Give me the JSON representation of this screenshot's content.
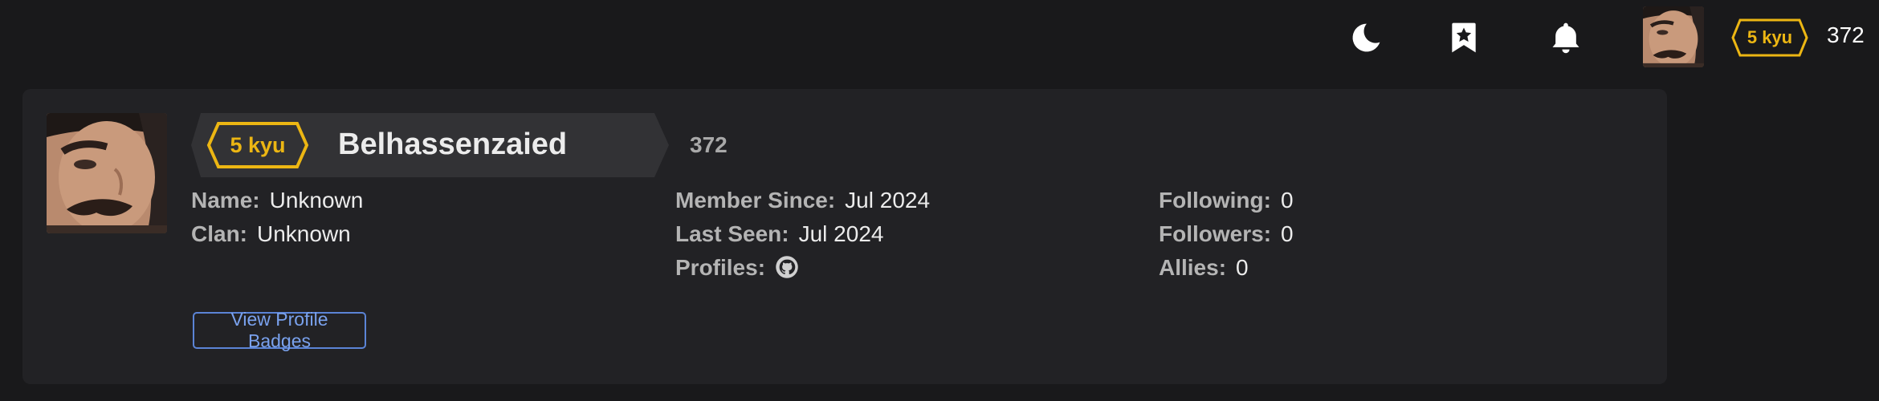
{
  "topbar": {
    "icons": [
      "moon-icon",
      "bookmark-star-icon",
      "bell-icon"
    ],
    "rank": "5 kyu",
    "honor": "372"
  },
  "profile": {
    "rank": "5 kyu",
    "username": "Belhassenzaied",
    "honor": "372",
    "col1": [
      {
        "label": "Name:",
        "value": "Unknown"
      },
      {
        "label": "Clan:",
        "value": "Unknown"
      }
    ],
    "col2": [
      {
        "label": "Member Since:",
        "value": "Jul 2024"
      },
      {
        "label": "Last Seen:",
        "value": "Jul 2024"
      },
      {
        "label": "Profiles:",
        "icon": "github-icon"
      }
    ],
    "col3": [
      {
        "label": "Following:",
        "value": "0"
      },
      {
        "label": "Followers:",
        "value": "0"
      },
      {
        "label": "Allies:",
        "value": "0"
      }
    ],
    "badges_button": "View Profile Badges"
  },
  "colors": {
    "background": "#19191b",
    "card": "#222225",
    "banner": "#323235",
    "rank_yellow": "#ecb613",
    "link_blue": "#5b84d6"
  }
}
